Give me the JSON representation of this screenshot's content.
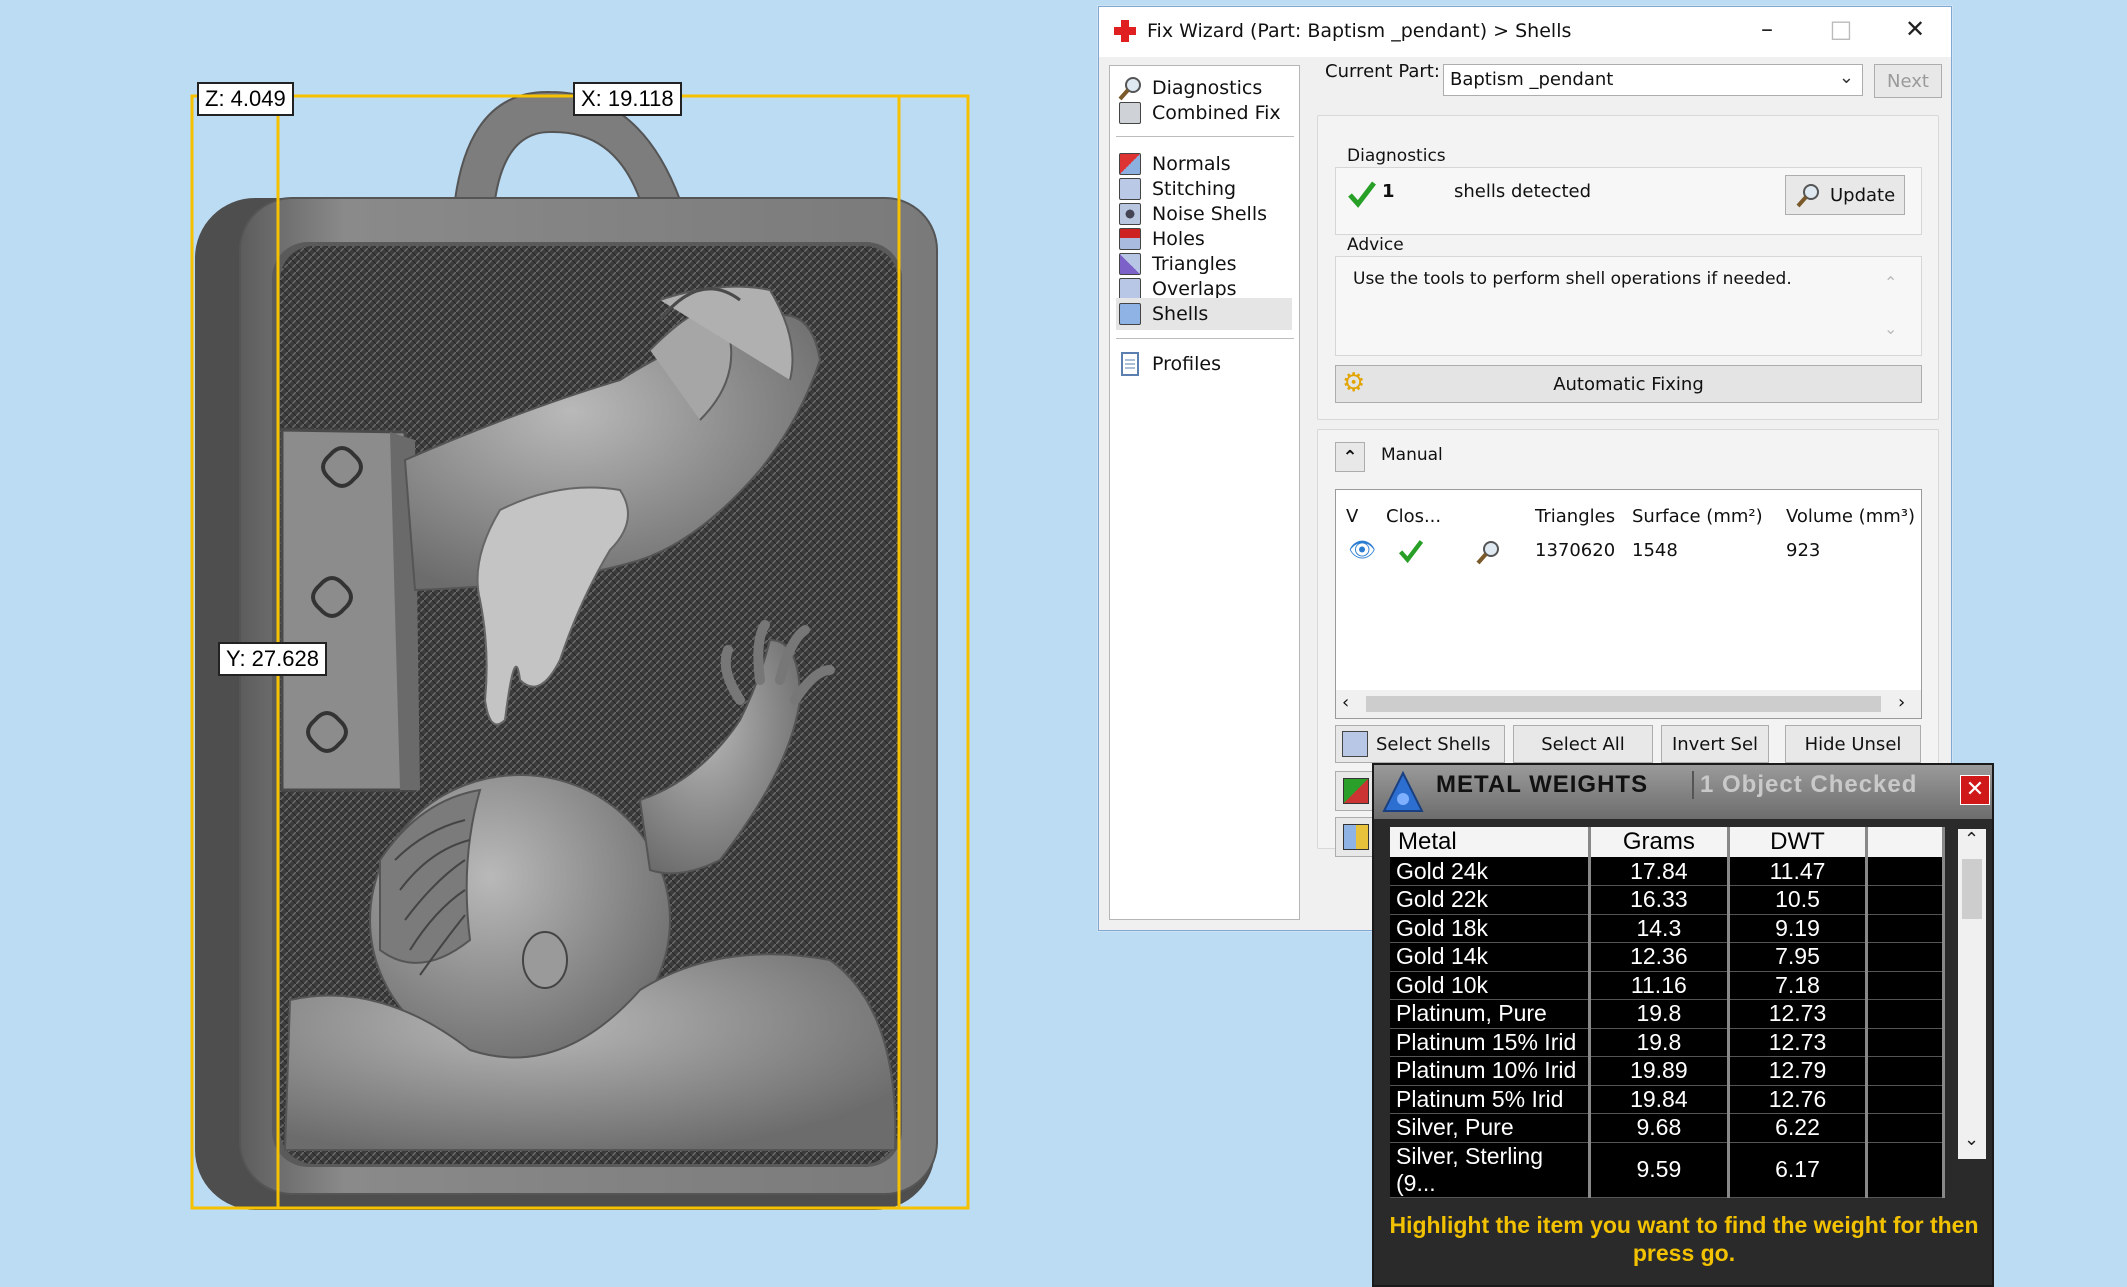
{
  "viewport": {
    "dim_z": "Z: 4.049",
    "dim_x": "X: 19.118",
    "dim_y": "Y: 27.628"
  },
  "wizard": {
    "title": "Fix Wizard (Part: Baptism _pendant) > Shells",
    "nav": {
      "diagnostics": "Diagnostics",
      "combined_fix": "Combined Fix",
      "normals": "Normals",
      "stitching": "Stitching",
      "noise_shells": "Noise Shells",
      "holes": "Holes",
      "triangles": "Triangles",
      "overlaps": "Overlaps",
      "shells": "Shells",
      "profiles": "Profiles"
    },
    "current_part_label": "Current Part:",
    "current_part_value": "Baptism _pendant",
    "next_label": "Next",
    "diagnostics_group": "Diagnostics",
    "shell_count": "1",
    "shells_detected": "shells detected",
    "update_label": "Update",
    "advice_group": "Advice",
    "advice_text": "Use the tools to perform shell operations if needed.",
    "automatic_fixing": "Automatic Fixing",
    "manual_label": "Manual",
    "table": {
      "col_v": "V",
      "col_closed": "Clos...",
      "col_triangles": "Triangles",
      "col_surface": "Surface (mm²)",
      "col_volume": "Volume (mm³)",
      "row": {
        "triangles": "1370620",
        "surface": "1548",
        "volume": "923"
      }
    },
    "select_shells": "Select Shells",
    "select_all": "Select All",
    "invert_sel": "Invert Sel",
    "hide_unsel": "Hide Unsel"
  },
  "metal": {
    "title": "METAL WEIGHTS",
    "subtitle": "1 Object Checked",
    "headers": {
      "metal": "Metal",
      "grams": "Grams",
      "dwt": "DWT"
    },
    "rows": [
      {
        "metal": "Gold 24k",
        "grams": "17.84",
        "dwt": "11.47"
      },
      {
        "metal": "Gold 22k",
        "grams": "16.33",
        "dwt": "10.5"
      },
      {
        "metal": "Gold 18k",
        "grams": "14.3",
        "dwt": "9.19"
      },
      {
        "metal": "Gold 14k",
        "grams": "12.36",
        "dwt": "7.95"
      },
      {
        "metal": "Gold 10k",
        "grams": "11.16",
        "dwt": "7.18"
      },
      {
        "metal": "Platinum, Pure",
        "grams": "19.8",
        "dwt": "12.73"
      },
      {
        "metal": "Platinum 15% Irid",
        "grams": "19.8",
        "dwt": "12.73"
      },
      {
        "metal": "Platinum 10% Irid",
        "grams": "19.89",
        "dwt": "12.79"
      },
      {
        "metal": "Platinum 5% Irid",
        "grams": "19.84",
        "dwt": "12.76"
      },
      {
        "metal": "Silver, Pure",
        "grams": "9.68",
        "dwt": "6.22"
      },
      {
        "metal": "Silver, Sterling (9...",
        "grams": "9.59",
        "dwt": "6.17"
      }
    ],
    "footer": "Highlight the item you want to find the weight for then press go."
  }
}
